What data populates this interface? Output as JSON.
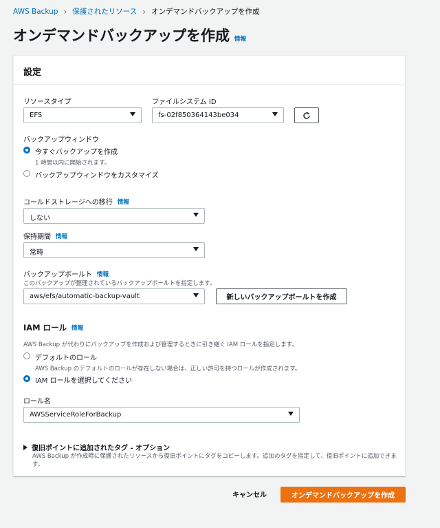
{
  "breadcrumb": {
    "items": [
      "AWS Backup",
      "保護されたリソース",
      "オンデマンドバックアップを作成"
    ]
  },
  "page": {
    "title": "オンデマンドバックアップを作成",
    "info_link": "情報"
  },
  "settings": {
    "header": "設定",
    "resource_type": {
      "label": "リソースタイプ",
      "value": "EFS"
    },
    "file_system_id": {
      "label": "ファイルシステム ID",
      "value": "fs-02f850364143be034"
    },
    "backup_window": {
      "label": "バックアップウィンドウ",
      "options": [
        {
          "label": "今すぐバックアップを作成",
          "desc": "1 時間以内に開始されます。",
          "checked": true
        },
        {
          "label": "バックアップウィンドウをカスタマイズ",
          "desc": "",
          "checked": false
        }
      ]
    },
    "cold_storage": {
      "label": "コールドストレージへの移行",
      "info": "情報",
      "value": "しない"
    },
    "retention": {
      "label": "保持期間",
      "info": "情報",
      "value": "常時"
    },
    "vault": {
      "label": "バックアップボールト",
      "info": "情報",
      "desc": "このバックアップが整理されているバックアップボールトを指定します。",
      "value": "aws/efs/automatic-backup-vault",
      "create_button": "新しいバックアップボールトを作成"
    },
    "iam": {
      "title": "IAM ロール",
      "info": "情報",
      "desc": "AWS Backup が代わりにバックアップを作成および管理するときに引き継ぐ IAM ロールを指定します。",
      "options": [
        {
          "label": "デフォルトのロール",
          "desc": "AWS Backup のデフォルトのロールが存在しない場合は、正しい許可を持つロールが作成されます。",
          "checked": false
        },
        {
          "label": "IAM ロールを選択してください",
          "desc": "",
          "checked": true
        }
      ],
      "role_name_label": "ロール名",
      "role_name_value": "AWSServiceRoleForBackup"
    },
    "tags": {
      "title": "復旧ポイントに追加されたタグ - オプション",
      "desc": "AWS Backup が作成時に保護されたリソースから復旧ポイントにタグをコピーします。追加のタグを指定して、復旧ポイントに追加できます。"
    }
  },
  "footer": {
    "cancel": "キャンセル",
    "submit": "オンデマンドバックアップを作成"
  },
  "colors": {
    "link": "#0073bb",
    "primary": "#ec7211",
    "background": "#f2f3f3"
  }
}
